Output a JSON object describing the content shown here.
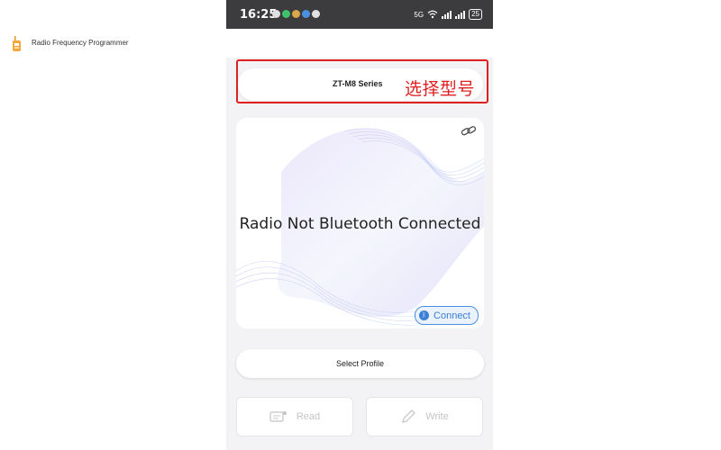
{
  "status_bar": {
    "time": "16:25",
    "battery": "25",
    "network": "5G",
    "notifications": [
      "chat-icon",
      "wechat-icon",
      "app-icon",
      "message-icon",
      "app-icon"
    ]
  },
  "app_bar": {
    "title": "Radio Frequency Programmer",
    "icon": "walkie-talkie-icon"
  },
  "model_selector": {
    "value": "ZT-M8 Series"
  },
  "annotation": {
    "text": "选择型号",
    "color": "#e02020"
  },
  "radio_card": {
    "status": "Radio Not Bluetooth Connected",
    "connect_label": "Connect"
  },
  "profile_button": {
    "label": "Select Profile"
  },
  "actions": {
    "read_label": "Read",
    "write_label": "Write"
  },
  "colors": {
    "accent": "#3b7fd8",
    "annotation": "#e02020",
    "wave_purple": "#c9b8f0",
    "wave_blue": "#b8d0f5"
  }
}
